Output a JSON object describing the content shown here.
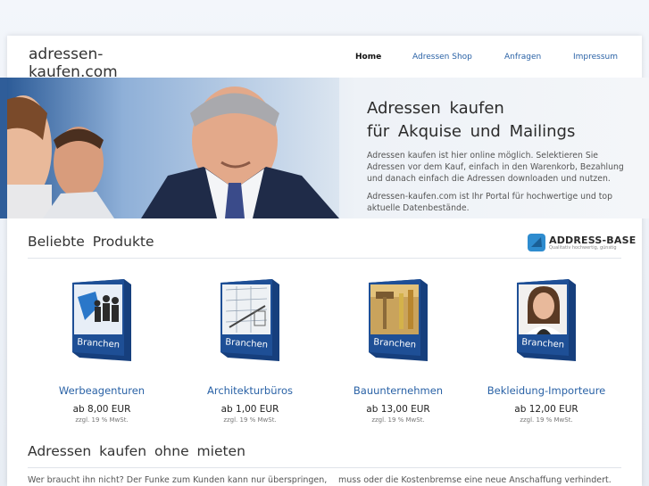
{
  "header": {
    "site_title": "adressen-kaufen.com",
    "nav": [
      {
        "label": "Home",
        "active": true
      },
      {
        "label": "Adressen Shop"
      },
      {
        "label": "Anfragen"
      },
      {
        "label": "Impressum"
      }
    ]
  },
  "hero": {
    "heading_line1": "Adressen kaufen",
    "heading_line2": "für Akquise und Mailings",
    "paragraph1": "Adressen kaufen ist hier online möglich. Selektieren Sie Adressen vor dem Kauf, einfach in den Warenkorb, Bezahlung und danach einfach die Adressen downloaden und nutzen.",
    "paragraph2": "Adressen-kaufen.com ist Ihr Portal für hochwertige und top aktuelle Datenbestände."
  },
  "products_section": {
    "title": "Beliebte Produkte",
    "brand_name": "ADDRESS-BASE",
    "brand_tagline": "Qualitativ hochwertig, günstig",
    "box_label": "Branchen",
    "items": [
      {
        "name": "Werbeagenturen",
        "price": "ab 8,00 EUR",
        "vat": "zzgl. 19 % MwSt.",
        "icon": "business-people-puzzle-icon"
      },
      {
        "name": "Architekturbüros",
        "price": "ab 1,00 EUR",
        "vat": "zzgl. 19 % MwSt.",
        "icon": "blueprint-drawing-icon"
      },
      {
        "name": "Bauunternehmen",
        "price": "ab 13,00 EUR",
        "vat": "zzgl. 19 % MwSt.",
        "icon": "construction-tools-icon"
      },
      {
        "name": "Bekleidung-Importeure",
        "price": "ab 12,00 EUR",
        "vat": "zzgl. 19 % MwSt.",
        "icon": "woman-portrait-icon"
      }
    ]
  },
  "second_section": {
    "title": "Adressen kaufen ohne mieten",
    "col1_text": "Wer braucht ihn nicht? Der Funke zum Kunden kann nur überspringen,",
    "col2_text": "muss oder die Kostenbremse eine neue Anschaffung verhindert."
  },
  "colors": {
    "accent": "#2a62a6",
    "box_blue": "#1e4f96"
  }
}
